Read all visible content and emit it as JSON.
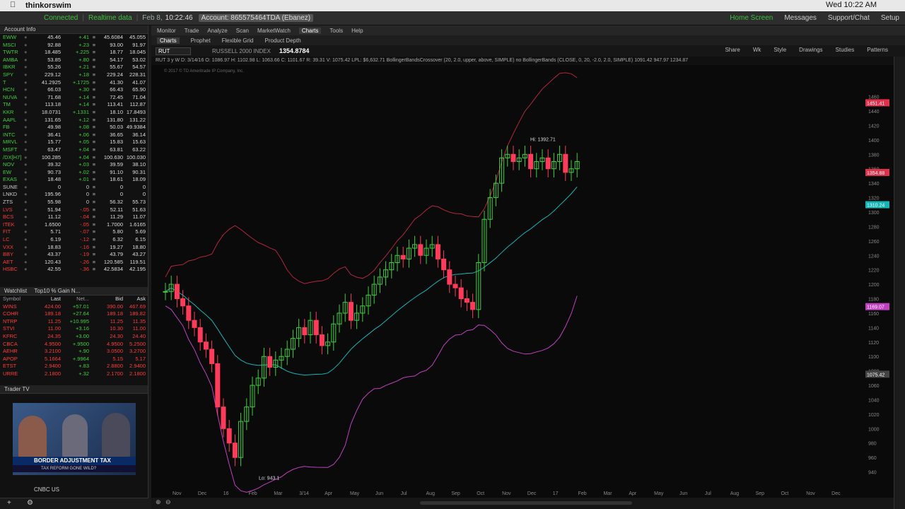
{
  "menubar": {
    "app": "thinkorswim",
    "datetime": "Wed 10:22 AM"
  },
  "statusbar": {
    "connected": "Connected",
    "realtime": "Realtime data",
    "date": "Feb 8,",
    "time": "10:22:46",
    "account": "Account: 865575464TDA (Ebanez)",
    "right": [
      "Home Screen",
      "Messages",
      "Support/Chat",
      "Setup"
    ]
  },
  "account_info": "Account Info",
  "quotes": [
    {
      "sym": "EWW",
      "last": "45.46",
      "chg": "+.41",
      "bid": "45.6084",
      "ask": "45.055",
      "dir": "up"
    },
    {
      "sym": "MSCI",
      "last": "92.88",
      "chg": "+.23",
      "bid": "93.00",
      "ask": "91.97",
      "dir": "up"
    },
    {
      "sym": "TWTR",
      "last": "18.485",
      "chg": "+.225",
      "bid": "18.77",
      "ask": "18.045",
      "dir": "up"
    },
    {
      "sym": "AMBA",
      "last": "53.85",
      "chg": "+.80",
      "bid": "54.17",
      "ask": "53.02",
      "dir": "up"
    },
    {
      "sym": "IBKR",
      "last": "55.26",
      "chg": "+.21",
      "bid": "55.67",
      "ask": "54.57",
      "dir": "up"
    },
    {
      "sym": "SPY",
      "last": "229.12",
      "chg": "+.18",
      "bid": "229.24",
      "ask": "228.31",
      "dir": "up"
    },
    {
      "sym": "T",
      "last": "41.2925",
      "chg": "+.1725",
      "bid": "41.30",
      "ask": "41.07",
      "dir": "up"
    },
    {
      "sym": "HCN",
      "last": "66.03",
      "chg": "+.30",
      "bid": "66.43",
      "ask": "65.90",
      "dir": "up"
    },
    {
      "sym": "NUVA",
      "last": "71.68",
      "chg": "+.14",
      "bid": "72.45",
      "ask": "71.04",
      "dir": "up"
    },
    {
      "sym": "TM",
      "last": "113.18",
      "chg": "+.14",
      "bid": "113.41",
      "ask": "112.87",
      "dir": "up"
    },
    {
      "sym": "KKR",
      "last": "18.0731",
      "chg": "+.1331",
      "bid": "18.10",
      "ask": "17.8493",
      "dir": "up"
    },
    {
      "sym": "AAPL",
      "last": "131.65",
      "chg": "+.12",
      "bid": "131.80",
      "ask": "131.22",
      "dir": "up"
    },
    {
      "sym": "FB",
      "last": "49.98",
      "chg": "+.08",
      "bid": "50.03",
      "ask": "49.9384",
      "dir": "up"
    },
    {
      "sym": "INTC",
      "last": "36.41",
      "chg": "+.06",
      "bid": "36.65",
      "ask": "36.14",
      "dir": "up"
    },
    {
      "sym": "MRVL",
      "last": "15.77",
      "chg": "+.05",
      "bid": "15.83",
      "ask": "15.63",
      "dir": "up"
    },
    {
      "sym": "MSFT",
      "last": "63.47",
      "chg": "+.04",
      "bid": "63.81",
      "ask": "63.22",
      "dir": "up"
    },
    {
      "sym": "/DX[H7]",
      "last": "100.285",
      "chg": "+.04",
      "bid": "100.630",
      "ask": "100.030",
      "dir": "up"
    },
    {
      "sym": "NOV",
      "last": "39.32",
      "chg": "+.03",
      "bid": "39.59",
      "ask": "38.10",
      "dir": "up"
    },
    {
      "sym": "EW",
      "last": "90.73",
      "chg": "+.02",
      "bid": "91.10",
      "ask": "90.31",
      "dir": "up"
    },
    {
      "sym": "EXAS",
      "last": "18.48",
      "chg": "+.01",
      "bid": "18.61",
      "ask": "18.09",
      "dir": "up"
    },
    {
      "sym": "SUNE",
      "last": "0",
      "chg": "0",
      "bid": "0",
      "ask": "0",
      "dir": "neu"
    },
    {
      "sym": "LNKD",
      "last": "195.96",
      "chg": "0",
      "bid": "0",
      "ask": "0",
      "dir": "neu"
    },
    {
      "sym": "ZTS",
      "last": "55.98",
      "chg": "0",
      "bid": "56.32",
      "ask": "55.73",
      "dir": "neu"
    },
    {
      "sym": "LVS",
      "last": "51.94",
      "chg": "-.05",
      "bid": "52.11",
      "ask": "51.63",
      "dir": "dn"
    },
    {
      "sym": "BCS",
      "last": "11.12",
      "chg": "-.04",
      "bid": "11.29",
      "ask": "11.07",
      "dir": "dn"
    },
    {
      "sym": "ITEK",
      "last": "1.6500",
      "chg": "-.05",
      "bid": "1.7000",
      "ask": "1.6165",
      "dir": "dn"
    },
    {
      "sym": "FIT",
      "last": "5.71",
      "chg": "-.07",
      "bid": "5.80",
      "ask": "5.69",
      "dir": "dn"
    },
    {
      "sym": "LC",
      "last": "6.19",
      "chg": "-.12",
      "bid": "6.32",
      "ask": "6.15",
      "dir": "dn"
    },
    {
      "sym": "VXX",
      "last": "18.83",
      "chg": "-.16",
      "bid": "19.27",
      "ask": "18.80",
      "dir": "dn"
    },
    {
      "sym": "BBY",
      "last": "43.37",
      "chg": "-.19",
      "bid": "43.79",
      "ask": "43.27",
      "dir": "dn"
    },
    {
      "sym": "AET",
      "last": "120.43",
      "chg": "-.26",
      "bid": "120.585",
      "ask": "119.51",
      "dir": "dn"
    },
    {
      "sym": "HSBC",
      "last": "42.55",
      "chg": "-.36",
      "bid": "42.5834",
      "ask": "42.195",
      "dir": "dn"
    }
  ],
  "watchlist": {
    "title": "Watchlist",
    "list": "Top10 % Gain N...",
    "headers": [
      "Symbol",
      "Last",
      "Net...",
      "Bid",
      "Ask"
    ],
    "rows": [
      {
        "sym": "WINS",
        "last": "424.00",
        "chg": "+57.01",
        "bid": "390.00",
        "ask": "467.69"
      },
      {
        "sym": "COHR",
        "last": "189.18",
        "chg": "+27.64",
        "bid": "189.18",
        "ask": "189.82"
      },
      {
        "sym": "NTRP",
        "last": "11.25",
        "chg": "+10.995",
        "bid": "11.25",
        "ask": "11.35"
      },
      {
        "sym": "STVI",
        "last": "11.00",
        "chg": "+3.16",
        "bid": "10.30",
        "ask": "11.00"
      },
      {
        "sym": "KFRC",
        "last": "24.35",
        "chg": "+3.00",
        "bid": "24.30",
        "ask": "24.40"
      },
      {
        "sym": "CBCA",
        "last": "4.9500",
        "chg": "+.9500",
        "bid": "4.9500",
        "ask": "5.2500"
      },
      {
        "sym": "AEHR",
        "last": "3.2100",
        "chg": "+.90",
        "bid": "3.0500",
        "ask": "3.2700"
      },
      {
        "sym": "APOP",
        "last": "5.1664",
        "chg": "+.9964",
        "bid": "5.15",
        "ask": "5.17"
      },
      {
        "sym": "ETST",
        "last": "2.9400",
        "chg": "+.83",
        "bid": "2.8800",
        "ask": "2.9400"
      },
      {
        "sym": "URRE",
        "last": "2.1800",
        "chg": "+.32",
        "bid": "2.1700",
        "ask": "2.1800"
      }
    ]
  },
  "tradertv": {
    "title": "Trader TV",
    "ticker": "BORDER ADJUSTMENT TAX",
    "subticker": "TAX REFORM GONE WILD?",
    "channel": "CNBC US"
  },
  "topnav": [
    "Monitor",
    "Trade",
    "Analyze",
    "Scan",
    "MarketWatch",
    "Charts",
    "Tools",
    "Help"
  ],
  "topnav_active": "Charts",
  "subnav": [
    "Charts",
    "Prophet",
    "Flexible Grid",
    "Product Depth"
  ],
  "symbol": {
    "sym": "RUT",
    "name": "RUSSELL 2000 INDEX",
    "price": "1354.8784"
  },
  "toolbar_right": [
    "Share",
    "Wk",
    "Style",
    "Drawings",
    "Studies",
    "Patterns"
  ],
  "study_line": "RUT 3 y W   D: 3/14/16   O: 1086.97   H: 1102.98   L: 1063.66   C: 1101.67   R: 39.31   V: 1075.42   LPL: $6,632.71   BollingerBandsCrossover (20, 2.0, upper, above, SIMPLE)   no   BollingerBands (CLOSE, 0, 20, -2.0, 2.0, SIMPLE)   1091.42   947.97   1234.87",
  "copyright": "© 2017 © TD Ameritrade IP Company, Inc.",
  "chart_data": {
    "type": "candlestick",
    "ylim": [
      920,
      1490
    ],
    "y_ticks": [
      940,
      960,
      980,
      1000,
      1020,
      1040,
      1060,
      1080,
      1100,
      1120,
      1140,
      1160,
      1180,
      1200,
      1220,
      1240,
      1260,
      1280,
      1300,
      1320,
      1340,
      1360,
      1380,
      1400,
      1420,
      1440,
      1460
    ],
    "x_ticks": [
      "Nov",
      "Dec",
      "16",
      "Feb",
      "Mar",
      "3/14",
      "Apr",
      "May",
      "Jun",
      "Jul",
      "Aug",
      "Sep",
      "Oct",
      "Nov",
      "Dec",
      "17",
      "Feb",
      "Mar",
      "Apr",
      "May",
      "Jun",
      "Jul",
      "Aug",
      "Sep",
      "Oct",
      "Nov",
      "Dec"
    ],
    "hi_label": "Hi: 1392.71",
    "lo_label": "Lo: 943.1",
    "price_labels": [
      {
        "text": "1451.41",
        "y": 1451.41,
        "color": "#e0304a"
      },
      {
        "text": "1354.88",
        "y": 1354.88,
        "color": "#e0304a"
      },
      {
        "text": "1310.24",
        "y": 1310.24,
        "color": "#13b5b5"
      },
      {
        "text": "1169.07",
        "y": 1169.07,
        "color": "#c040c0"
      },
      {
        "text": "1075.42",
        "y": 1075.42,
        "color": "#444"
      }
    ],
    "closes": [
      1190,
      1200,
      1180,
      1170,
      1150,
      1140,
      1120,
      1110,
      1090,
      1030,
      1000,
      980,
      960,
      1010,
      1030,
      1060,
      1070,
      1100,
      1085,
      1095,
      1100,
      1110,
      1125,
      1140,
      1130,
      1150,
      1130,
      1115,
      1120,
      1145,
      1160,
      1175,
      1150,
      1160,
      1170,
      1185,
      1200,
      1210,
      1220,
      1230,
      1240,
      1235,
      1250,
      1255,
      1240,
      1250,
      1255,
      1235,
      1220,
      1200,
      1195,
      1180,
      1175,
      1165,
      1230,
      1290,
      1320,
      1340,
      1375,
      1380,
      1370,
      1375,
      1380,
      1360,
      1370,
      1375,
      1360,
      1370,
      1380,
      1355,
      1360,
      1370
    ]
  }
}
